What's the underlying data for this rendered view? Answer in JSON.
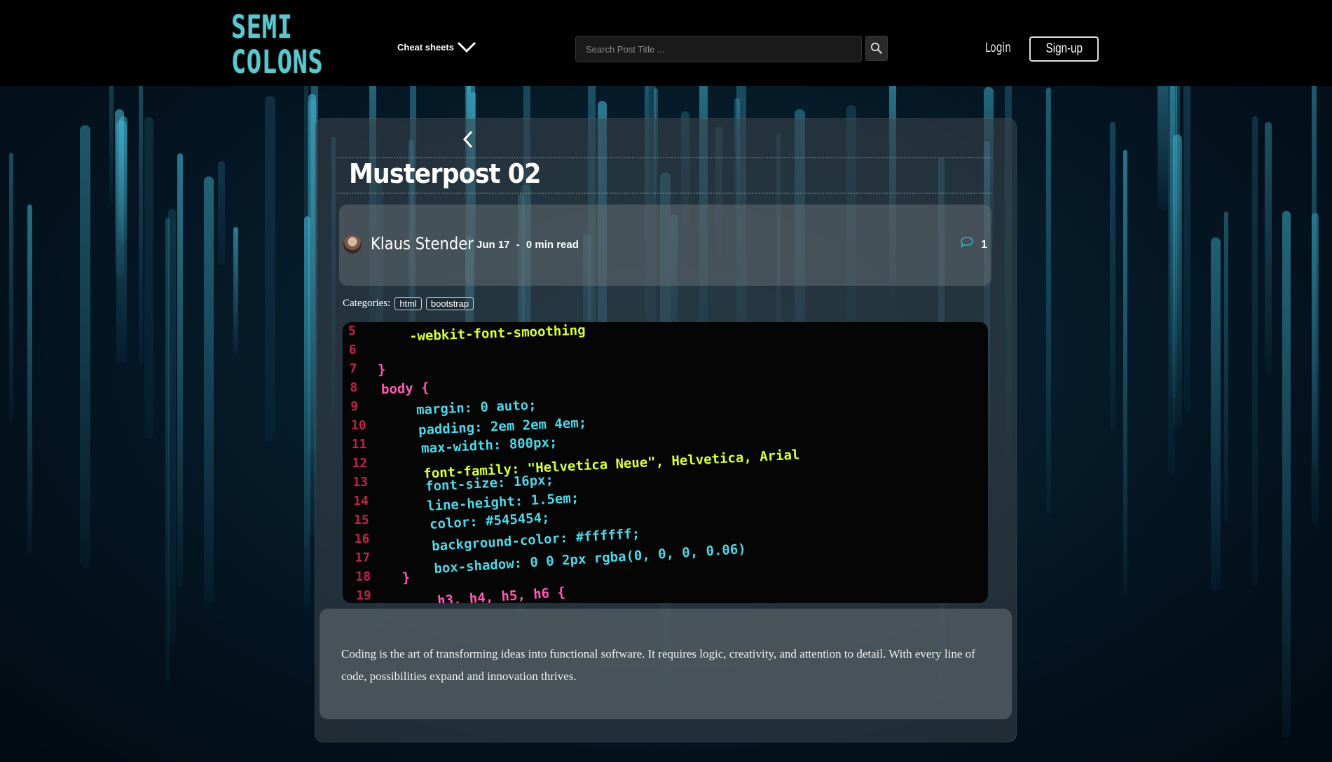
{
  "header": {
    "logo_line1": "SEMI",
    "logo_line2": "COLONS",
    "cheat_sheets_label": "Cheat sheets",
    "search_placeholder": "Search Post Title ...",
    "login_label": "Login",
    "signup_label": "Sign-up"
  },
  "post": {
    "title": "Musterpost 02",
    "author": "Klaus Stender",
    "date": "Jun 17",
    "separator": "-",
    "read_time": "0 min read",
    "comment_count": "1",
    "categories_label": "Categories:",
    "categories": [
      "html",
      "bootstrap"
    ],
    "body": "Coding is the art of transforming ideas into functional software. It requires logic, creativity, and attention to detail. With every line of code, possibilities expand and innovation thrives."
  },
  "hero_code": {
    "line_numbers": [
      "5",
      "6",
      "7",
      "8",
      "9",
      "10",
      "11",
      "12",
      "13",
      "14",
      "15",
      "16",
      "17",
      "18",
      "19"
    ],
    "lines": [
      "-webkit-font-smoothing",
      "}",
      "body {",
      "margin: 0 auto;",
      "padding: 2em 2em 4em;",
      "max-width: 800px;",
      "font-family: \"Helvetica Neue\", Helvetica, Arial",
      "font-size: 16px;",
      "line-height: 1.5em;",
      "color: #545454;",
      "background-color: #ffffff;",
      "box-shadow: 0 0 2px rgba(0, 0, 0, 0.06)",
      "}",
      "h3, h4, h5, h6 {"
    ]
  },
  "colors": {
    "logo": "#5fc6cc",
    "accent_teal": "#2fb5c9",
    "code_property": "#4fd6e8",
    "code_value": "#ff5ab4",
    "code_string": "#d8ff3a"
  }
}
